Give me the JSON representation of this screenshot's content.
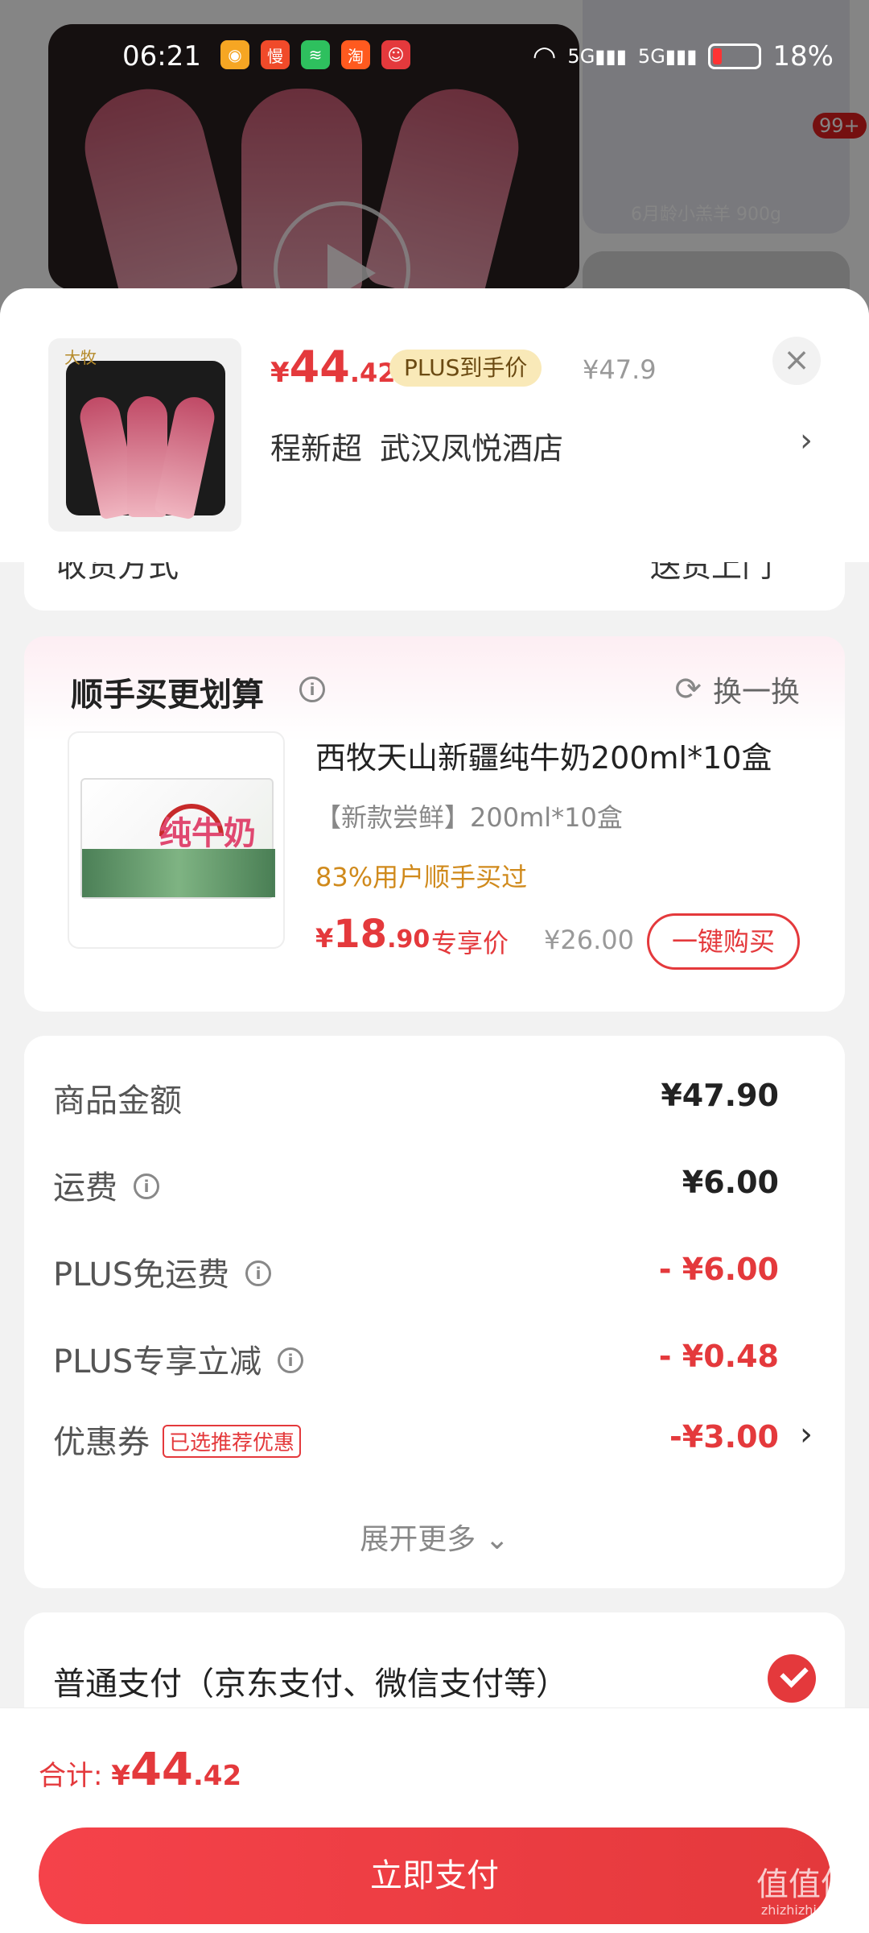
{
  "status_bar": {
    "time": "06:21",
    "battery_text": "18%",
    "signal_1": "5G",
    "signal_2": "5G",
    "apps": [
      {
        "icon": "weibo-icon",
        "color": "#f6a623"
      },
      {
        "icon": "manhua-icon",
        "color": "#f04a2a",
        "glyph": "慢"
      },
      {
        "icon": "spotify-icon",
        "color": "#2ec05e"
      },
      {
        "icon": "taobao-icon",
        "color": "#ff5a1f",
        "glyph": "淘"
      },
      {
        "icon": "jd-icon",
        "color": "#e4393c"
      }
    ]
  },
  "background": {
    "side_label": "6月龄小羔羊 900g",
    "badge": "99+"
  },
  "product": {
    "price_currency": "¥",
    "price_int": "44",
    "price_dec": ".42",
    "plus_tag": "PLUS到手价",
    "orig_price": "¥47.9",
    "addr_name": "程新超",
    "addr_place": "武汉凤悦酒店",
    "close_icon": "close-icon",
    "thumb_logo": "大牧"
  },
  "partial_row": {
    "label": "收货方式",
    "value": "送货上门"
  },
  "upsell": {
    "title": "顺手买更划算",
    "swap_label": "换一换",
    "name": "西牧天山新疆纯牛奶200ml*10盒",
    "spec": "【新款尝鲜】200ml*10盒",
    "social": "83%用户顺手买过",
    "price_currency": "¥",
    "price_int": "18",
    "price_dec": ".90",
    "price_tag": "专享价",
    "orig_price": "¥26.00",
    "buy_label": "一键购买",
    "image_word": "纯牛奶"
  },
  "summary": {
    "rows": [
      {
        "label": "商品金额",
        "value": "¥47.90"
      },
      {
        "label": "运费",
        "value": "¥6.00"
      },
      {
        "label": "PLUS免运费",
        "value": "- ¥6.00"
      },
      {
        "label": "PLUS专享立减",
        "value": "- ¥0.48"
      },
      {
        "label": "优惠券",
        "value": "-¥3.00",
        "tag": "已选推荐优惠"
      }
    ],
    "expand_label": "展开更多 ⌄"
  },
  "payment": {
    "method": "普通支付（京东支付、微信支付等）"
  },
  "footer": {
    "total_label": "合计: ",
    "total_currency": "¥",
    "total_int": "44",
    "total_dec": ".42",
    "pay_button": "立即支付",
    "watermark": "值值值",
    "watermark_url": "zhizhizhi.com"
  },
  "colors": {
    "accent": "#e4393c",
    "plus_bg": "#f9e9b8",
    "social": "#d08a1c"
  }
}
